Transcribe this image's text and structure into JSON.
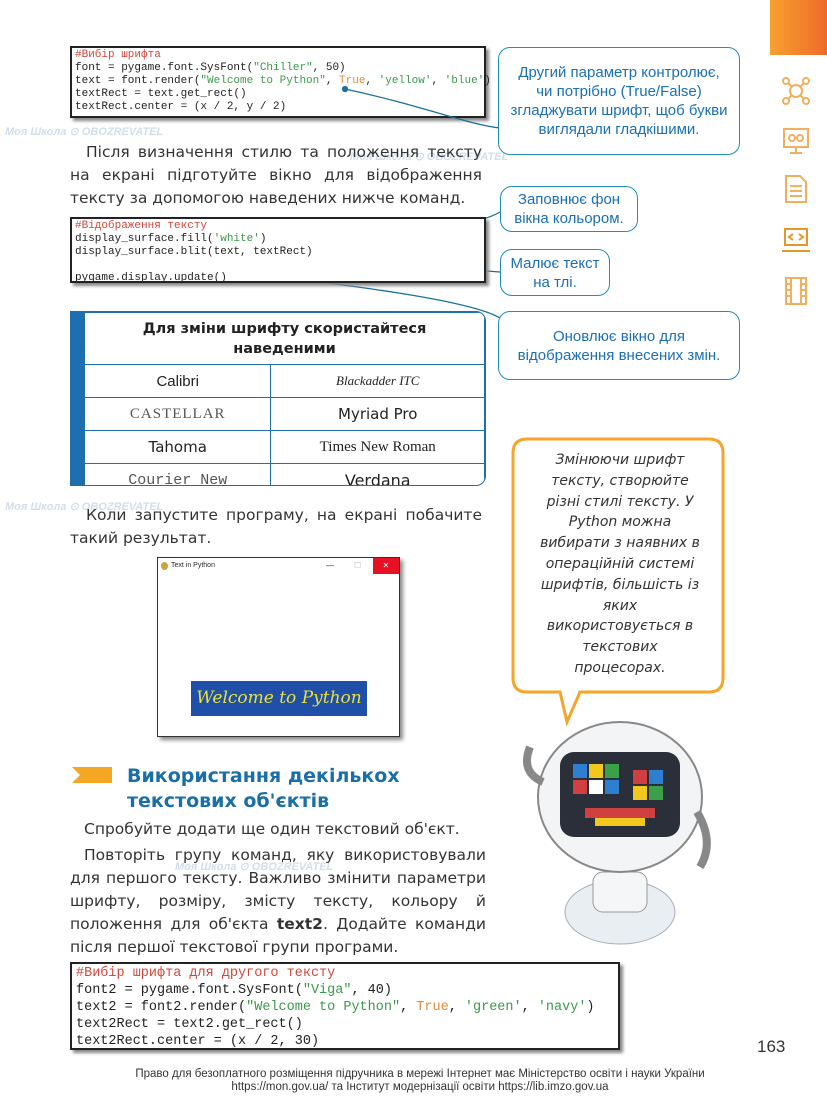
{
  "watermark": {
    "text1": "Моя Школа",
    "text2": "OBOZREVATEL"
  },
  "code1": {
    "comment": "#Вибір шрифта",
    "line1_a": "font = pygame.font.SysFont(",
    "line1_str": "\"Chiller\"",
    "line1_b": ", 50)",
    "line2_a": "text = font.render(",
    "line2_str1": "\"Welcome to Python\"",
    "line2_sep": ", ",
    "line2_kw": "True",
    "line2_sep2": ", ",
    "line2_str2": "'yellow'",
    "line2_sep3": ", ",
    "line2_str3": "'blue'",
    "line2_b": ")",
    "line3": "textRect = text.get_rect()",
    "line4": "textRect.center = (x / 2, y / 2)"
  },
  "callout1": "Другий параметр контролює, чи потрібно (True/False) згладжувати шрифт, щоб букви виглядали гладкішими.",
  "para1": "Після визначення стилю та положення тексту на екрані підготуйте вікно для відображення тексту за допомогою наведених нижче команд.",
  "code2": {
    "comment": "#Відображення тексту",
    "line1_a": "display_surface.fill(",
    "line1_str": "'white'",
    "line1_b": ")",
    "line2": "display_surface.blit(text, textRect)",
    "line3": "pygame.display.update()"
  },
  "callout2": "Заповнює фон вікна кольором.",
  "callout3": "Малює текст на тлі.",
  "callout4": "Оновлює вікно для відображення внесених змін.",
  "font_table": {
    "header": "Для зміни шрифту скористайтеся наведеними",
    "rows": [
      [
        "Calibri",
        "Blackadder ITC"
      ],
      [
        "CASTELLAR",
        "Myriad Pro"
      ],
      [
        "Tahoma",
        "Times New Roman"
      ],
      [
        "Courier New",
        "Verdana"
      ]
    ]
  },
  "para2": "Коли запустите програму, на екрані побачите такий результат.",
  "window": {
    "title": "Text in Python",
    "minimize": "—",
    "maximize": "☐",
    "close": "✕",
    "content": "Welcome to Python",
    "content_bg": "#1f4fa8",
    "content_fg": "#e8e23a",
    "close_bg": "#e81123"
  },
  "speech_bubble": "Змінюючи шрифт тексту, створюйте різні стилі тексту. У Python можна вибирати з наявних в операційній системі шрифтів, більшість із яких використовується в текстових процесорах.",
  "section": {
    "title": "Використання декількох текстових об'єктів"
  },
  "para3": "Спробуйте додати ще один текстовий об'єкт.",
  "para4_a": "Повторіть групу команд, яку використовували для першого тексту. Важливо змінити параметри шрифту, розміру, змісту тексту, кольору й положення для об'єкта ",
  "para4_bold": "text2",
  "para4_b": ". Додайте команди після першої текстової групи програми.",
  "code3": {
    "comment": "#Вибір шрифта для другого тексту",
    "line1_a": "font2 = pygame.font.SysFont(",
    "line1_str": "\"Viga\"",
    "line1_b": ", 40)",
    "line2_a": "text2 = font2.render(",
    "line2_str1": "\"Welcome to Python\"",
    "line2_sep": ", ",
    "line2_kw": "True",
    "line2_sep2": ", ",
    "line2_str2": "'green'",
    "line2_sep3": ", ",
    "line2_str3": "'navy'",
    "line2_b": ")",
    "line3": "text2Rect = text2.get_rect()",
    "line4": "text2Rect.center = (x / 2, 30)"
  },
  "page_number": "163",
  "footer": {
    "line1": "Право для безоплатного розміщення підручника в мережі Інтернет має Міністерство освіти і науки України",
    "line2": "https://mon.gov.ua/ та Інститут модернізації освіти https://lib.imzo.gov.ua"
  },
  "colors": {
    "accent_orange": "#f39a2b",
    "heading_blue": "#1a6fa8",
    "callout_border": "#1d8fb8"
  },
  "side_icons": [
    "network-icon",
    "monitor-robot-icon",
    "document-icon",
    "laptop-code-icon",
    "film-icon"
  ]
}
